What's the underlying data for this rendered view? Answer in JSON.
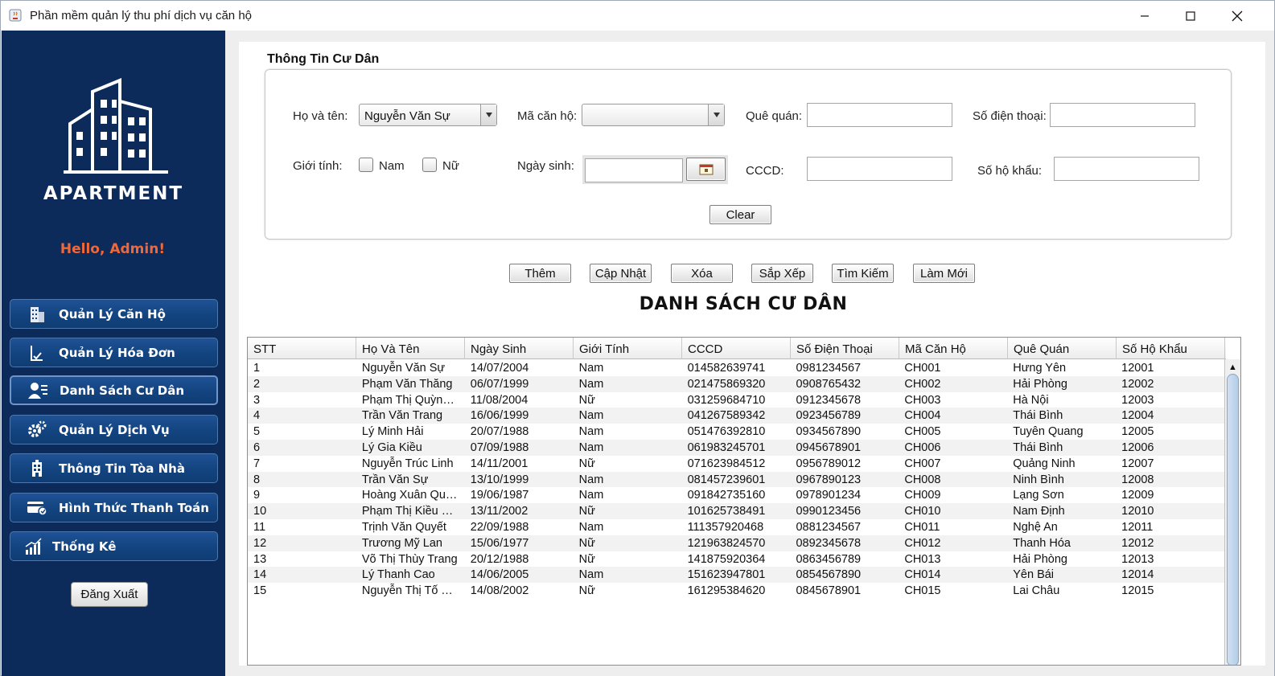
{
  "window": {
    "title": "Phần mềm quản lý thu phí dịch vụ căn hộ",
    "minimize_icon": "minimize-icon",
    "maximize_icon": "maximize-icon",
    "close_icon": "close-icon"
  },
  "sidebar": {
    "logo_text": "APARTMENT",
    "greeting": "Hello, Admin!",
    "items": [
      {
        "label": "Quản Lý Căn Hộ",
        "icon": "building-icon"
      },
      {
        "label": "Quản Lý Hóa Đơn",
        "icon": "invoice-icon"
      },
      {
        "label": "Danh Sách Cư Dân",
        "icon": "residents-icon"
      },
      {
        "label": "Quản Lý Dịch Vụ",
        "icon": "gears-icon"
      },
      {
        "label": "Thông Tin Tòa Nhà",
        "icon": "tower-icon"
      },
      {
        "label": "Hình Thức Thanh Toán",
        "icon": "payment-icon"
      },
      {
        "label": "Thống Kê",
        "icon": "stats-icon"
      }
    ],
    "active_item": "Danh Sách Cư Dân",
    "logout_label": "Đăng Xuất"
  },
  "form": {
    "group_title": "Thông Tin Cư Dân",
    "name_label": "Họ và tên:",
    "name_value": "Nguyễn Văn Sự",
    "apartment_label": "Mã căn hộ:",
    "apartment_value": "",
    "hometown_label": "Quê quán:",
    "hometown_value": "",
    "phone_label": "Số điện thoại:",
    "phone_value": "",
    "gender_label": "Giới tính:",
    "gender_male": "Nam",
    "gender_female": "Nữ",
    "birth_label": "Ngày sinh:",
    "birth_value": "",
    "cccd_label": "CCCD:",
    "cccd_value": "",
    "household_label": "Số hộ khẩu:",
    "household_value": "",
    "clear_label": "Clear"
  },
  "actions": {
    "add": "Thêm",
    "update": "Cập Nhật",
    "delete": "Xóa",
    "sort": "Sắp Xếp",
    "search": "Tìm Kiếm",
    "refresh": "Làm Mới"
  },
  "list_title": "DANH SÁCH CƯ DÂN",
  "table": {
    "columns": [
      "STT",
      "Họ Và Tên",
      "Ngày Sinh",
      "Giới Tính",
      "CCCD",
      "Số Điện Thoại",
      "Mã Căn Hộ",
      "Quê Quán",
      "Số Hộ Khẩu"
    ],
    "rows": [
      [
        "1",
        "Nguyễn Văn Sự",
        "14/07/2004",
        "Nam",
        "014582639741",
        "0981234567",
        "CH001",
        "Hưng Yên",
        "12001"
      ],
      [
        "2",
        "Phạm Văn Thăng",
        "06/07/1999",
        "Nam",
        "021475869320",
        "0908765432",
        "CH002",
        "Hải Phòng",
        "12002"
      ],
      [
        "3",
        "Phạm Thị Quỳnh ...",
        "11/08/2004",
        "Nữ",
        "031259684710",
        "0912345678",
        "CH003",
        "Hà Nội",
        "12003"
      ],
      [
        "4",
        "Trần Văn Trang",
        "16/06/1999",
        "Nam",
        "041267589342",
        "0923456789",
        "CH004",
        "Thái Bình",
        "12004"
      ],
      [
        "5",
        "Lý Minh Hải",
        "20/07/1988",
        "Nam",
        "051476392810",
        "0934567890",
        "CH005",
        "Tuyên Quang",
        "12005"
      ],
      [
        "6",
        "Lý Gia Kiều",
        "07/09/1988",
        "Nam",
        "061983245701",
        "0945678901",
        "CH006",
        "Thái Bình",
        "12006"
      ],
      [
        "7",
        "Nguyễn Trúc Linh",
        "14/11/2001",
        "Nữ",
        "071623984512",
        "0956789012",
        "CH007",
        "Quảng Ninh",
        "12007"
      ],
      [
        "8",
        "Trần Văn Sự",
        "13/10/1999",
        "Nam",
        "081457239601",
        "0967890123",
        "CH008",
        "Ninh Bình",
        "12008"
      ],
      [
        "9",
        "Hoàng Xuân Qua...",
        "19/06/1987",
        "Nam",
        "091842735160",
        "0978901234",
        "CH009",
        "Lạng Sơn",
        "12009"
      ],
      [
        "10",
        "Phạm Thị Kiều N...",
        "13/11/2002",
        "Nữ",
        "101625738491",
        "0990123456",
        "CH010",
        "Nam Định",
        "12010"
      ],
      [
        "11",
        "Trịnh Văn Quyết",
        "22/09/1988",
        "Nam",
        "111357920468",
        "0881234567",
        "CH011",
        "Nghệ An",
        "12011"
      ],
      [
        "12",
        "Trương Mỹ Lan",
        "15/06/1977",
        "Nữ",
        "121963824570",
        "0892345678",
        "CH012",
        "Thanh Hóa",
        "12012"
      ],
      [
        "13",
        "Võ Thị Thùy Trang",
        "20/12/1988",
        "Nữ",
        "141875920364",
        "0863456789",
        "CH013",
        "Hải Phòng",
        "12013"
      ],
      [
        "14",
        "Lý Thanh Cao",
        "14/06/2005",
        "Nam",
        "151623947801",
        "0854567890",
        "CH014",
        "Yên Bái",
        "12014"
      ],
      [
        "15",
        "Nguyễn Thị Tố Tri...",
        "14/08/2002",
        "Nữ",
        "161295384620",
        "0845678901",
        "CH015",
        "Lai Châu",
        "12015"
      ]
    ]
  },
  "colors": {
    "sidebar_bg": "#0c2b5a",
    "nav_button": "#134480",
    "greeting": "#f0683a"
  }
}
